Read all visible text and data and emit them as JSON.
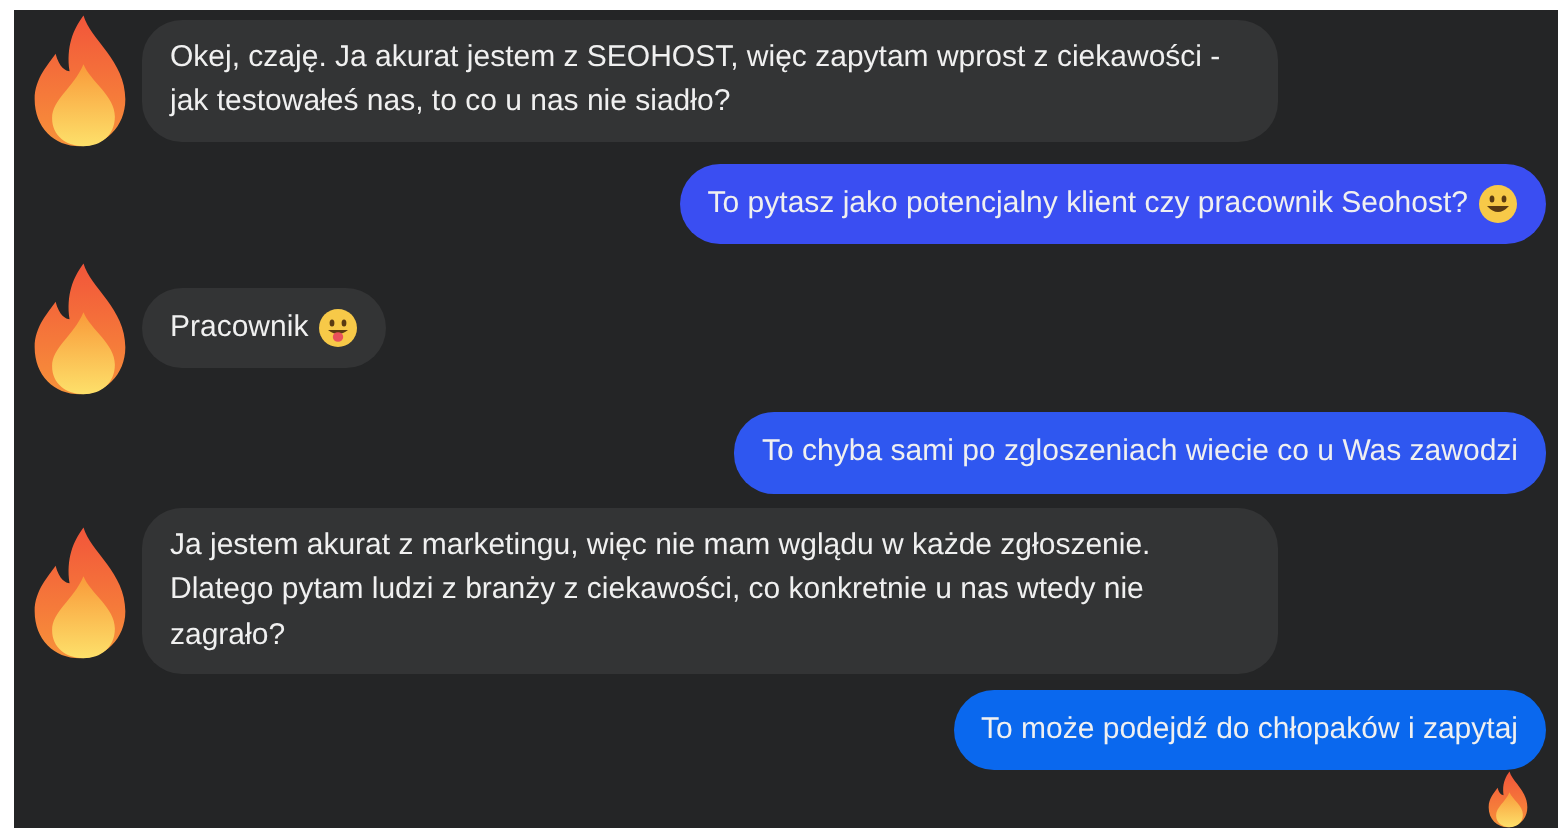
{
  "messages": [
    {
      "kind": "incoming",
      "avatar": true,
      "text": "Okej, czaję. Ja akurat jestem z SEOHOST, więc zapytam wprost z ciekawości - jak testowałeś nas, to co u nas nie siadło?"
    },
    {
      "kind": "outgoing",
      "color": "#3a4ef2",
      "text": "To pytasz jako potencjalny klient czy pracownik Seohost?",
      "emoji": {
        "kind": "smile"
      }
    },
    {
      "kind": "incoming",
      "avatar": true,
      "text": "Pracownik",
      "emoji": {
        "kind": "tongue"
      }
    },
    {
      "kind": "outgoing",
      "color": "#2f57f0",
      "text": "To chyba sami po zgloszeniach wiecie co u Was zawodzi"
    },
    {
      "kind": "incoming",
      "avatar": true,
      "text": "Ja jestem akurat z marketingu, więc nie mam wglądu w każde zgłoszenie. Dlatego pytam ludzi z branży z ciekawości, co konkretnie u nas wtedy nie zagrało?"
    },
    {
      "kind": "outgoing",
      "color": "#0a68ee",
      "text": "To może podejdź do chłopaków i zapytaj"
    }
  ],
  "seen_indicator": true
}
